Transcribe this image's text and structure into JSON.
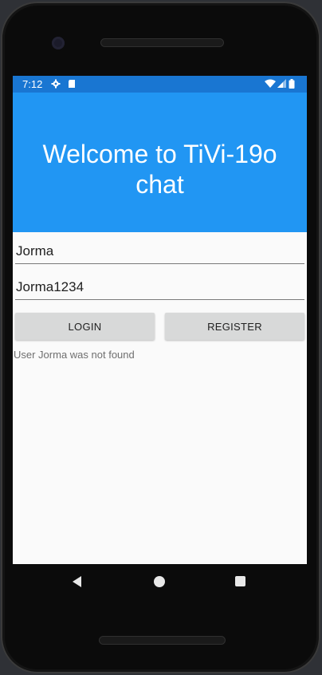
{
  "status_bar": {
    "time": "7:12",
    "icons": [
      "settings-icon",
      "sd-card-icon",
      "wifi-icon",
      "signal-icon",
      "battery-icon"
    ]
  },
  "header": {
    "title": "Welcome to TiVi-19o chat",
    "background_color": "#2196F3",
    "status_bar_color": "#1976D2"
  },
  "form": {
    "username_value": "Jorma",
    "password_value": "Jorma1234",
    "login_label": "LOGIN",
    "register_label": "REGISTER",
    "status_message": "User Jorma was not found"
  },
  "nav": {
    "icons": [
      "back-icon",
      "home-icon",
      "recents-icon"
    ]
  }
}
